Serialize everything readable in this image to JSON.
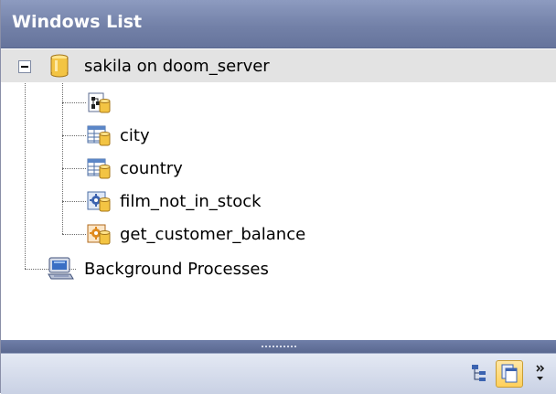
{
  "header": {
    "title": "Windows List"
  },
  "tree": {
    "root": {
      "label": "sakila on doom_server",
      "expanded": true,
      "icon": "database-icon"
    },
    "children": [
      {
        "label": "",
        "icon": "query-builder-icon"
      },
      {
        "label": "city",
        "icon": "table-icon"
      },
      {
        "label": "country",
        "icon": "table-icon"
      },
      {
        "label": "film_not_in_stock",
        "icon": "procedure-icon"
      },
      {
        "label": "get_customer_balance",
        "icon": "function-icon"
      }
    ],
    "background": {
      "label": "Background Processes",
      "icon": "computer-icon"
    }
  },
  "footer": {
    "buttons": [
      {
        "name": "tree-view-button",
        "icon": "tree-view-icon",
        "active": false
      },
      {
        "name": "windows-view-button",
        "icon": "windows-icon",
        "active": true
      },
      {
        "name": "more-options-button",
        "icon": "chevron-more-icon",
        "active": false
      }
    ]
  },
  "colors": {
    "header": "#7381a8",
    "selection": "#e3e3e3",
    "active_button": "#ffd05a"
  }
}
